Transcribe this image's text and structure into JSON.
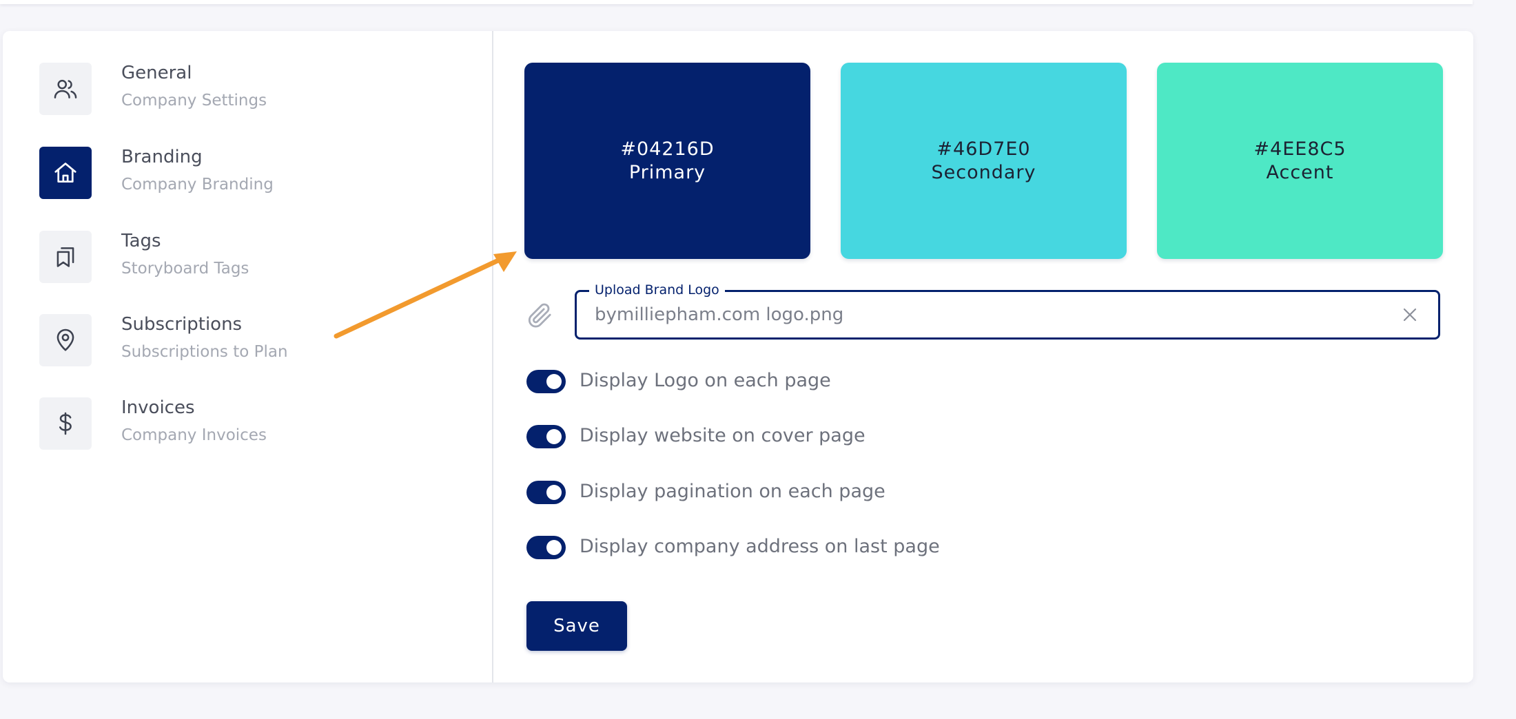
{
  "sidebar": {
    "items": [
      {
        "title": "General",
        "subtitle": "Company Settings",
        "icon": "users-icon"
      },
      {
        "title": "Branding",
        "subtitle": "Company Branding",
        "icon": "home-icon",
        "active": true
      },
      {
        "title": "Tags",
        "subtitle": "Storyboard Tags",
        "icon": "bookmarks-icon"
      },
      {
        "title": "Subscriptions",
        "subtitle": "Subscriptions to Plan",
        "icon": "map-pin-icon"
      },
      {
        "title": "Invoices",
        "subtitle": "Company Invoices",
        "icon": "dollar-icon"
      }
    ]
  },
  "swatches": [
    {
      "hex": "#04216D",
      "label": "Primary",
      "color": "#04216D",
      "text_color": "#FFFFFF"
    },
    {
      "hex": "#46D7E0",
      "label": "Secondary",
      "color": "#46D7E0",
      "text_color": "#1C2233"
    },
    {
      "hex": "#4EE8C5",
      "label": "Accent",
      "color": "#4EE8C5",
      "text_color": "#1C2233"
    }
  ],
  "upload": {
    "label": "Upload Brand Logo",
    "value": "bymilliepham.com logo.png",
    "attach_icon": "paperclip-icon",
    "clear_icon": "close-icon"
  },
  "toggles": [
    {
      "label": "Display Logo on each page",
      "on": true
    },
    {
      "label": "Display website on cover page",
      "on": true
    },
    {
      "label": "Display pagination on each page",
      "on": true
    },
    {
      "label": "Display company address on last page",
      "on": true
    }
  ],
  "actions": {
    "save_label": "Save"
  },
  "annotation": {
    "arrow_color": "#F29A2E"
  },
  "theme": {
    "accent": "#04216D"
  }
}
